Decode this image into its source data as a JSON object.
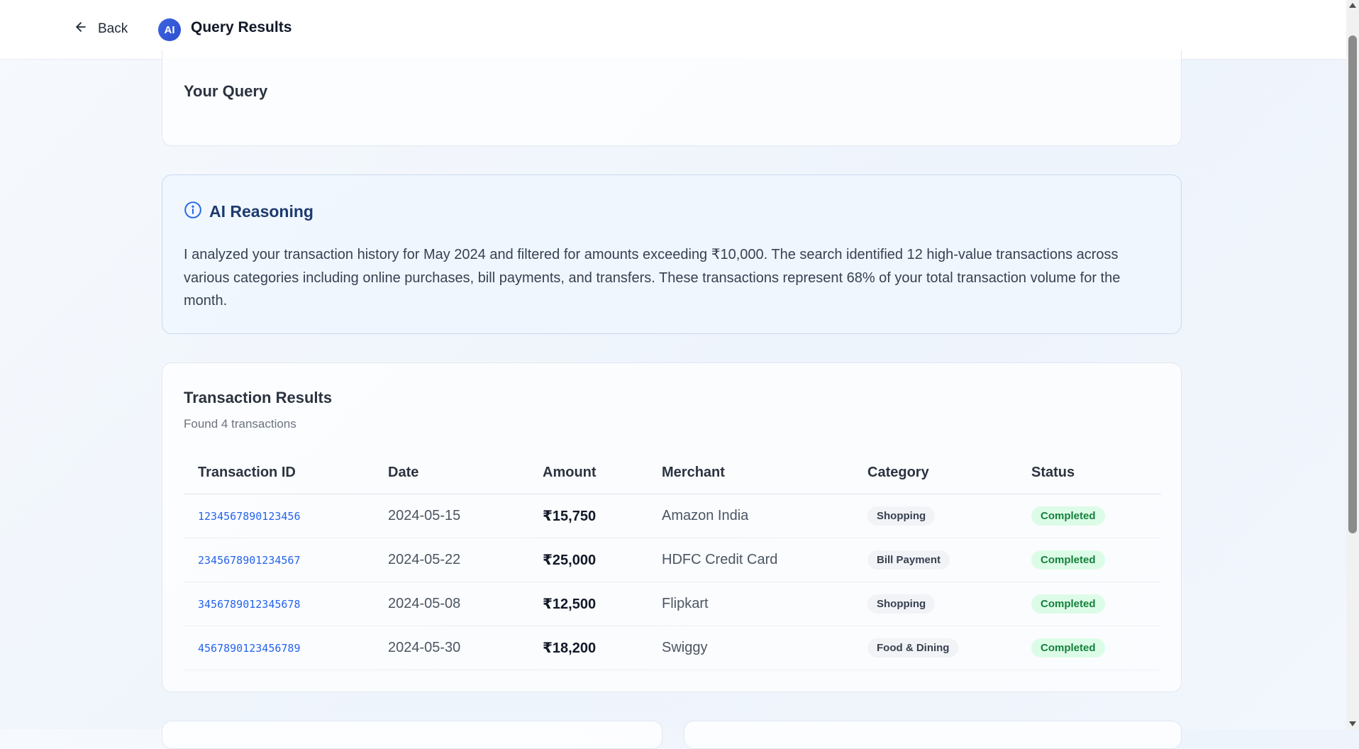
{
  "header": {
    "back_label": "Back",
    "ai_badge": "AI",
    "title": "Query Results"
  },
  "query": {
    "title": "Your Query"
  },
  "reasoning": {
    "title": "AI Reasoning",
    "text": "I analyzed your transaction history for May 2024 and filtered for amounts exceeding ₹10,000. The search identified 12 high-value transactions across various categories including online purchases, bill payments, and transfers. These transactions represent 68% of your total transaction volume for the month."
  },
  "results": {
    "title": "Transaction Results",
    "subtitle": "Found 4 transactions",
    "columns": [
      "Transaction ID",
      "Date",
      "Amount",
      "Merchant",
      "Category",
      "Status"
    ],
    "rows": [
      {
        "id": "1234567890123456",
        "date": "2024-05-15",
        "amount": "₹15,750",
        "merchant": "Amazon India",
        "category": "Shopping",
        "status": "Completed"
      },
      {
        "id": "2345678901234567",
        "date": "2024-05-22",
        "amount": "₹25,000",
        "merchant": "HDFC Credit Card",
        "category": "Bill Payment",
        "status": "Completed"
      },
      {
        "id": "3456789012345678",
        "date": "2024-05-08",
        "amount": "₹12,500",
        "merchant": "Flipkart",
        "category": "Shopping",
        "status": "Completed"
      },
      {
        "id": "4567890123456789",
        "date": "2024-05-30",
        "amount": "₹18,200",
        "merchant": "Swiggy",
        "category": "Food & Dining",
        "status": "Completed"
      }
    ]
  },
  "icons": {
    "back": "arrow-left-icon",
    "reasoning": "info-icon"
  },
  "colors": {
    "accent": "#2563eb",
    "badge": "#3b63e0",
    "status_bg": "#dcfce7",
    "status_text": "#15803d"
  }
}
